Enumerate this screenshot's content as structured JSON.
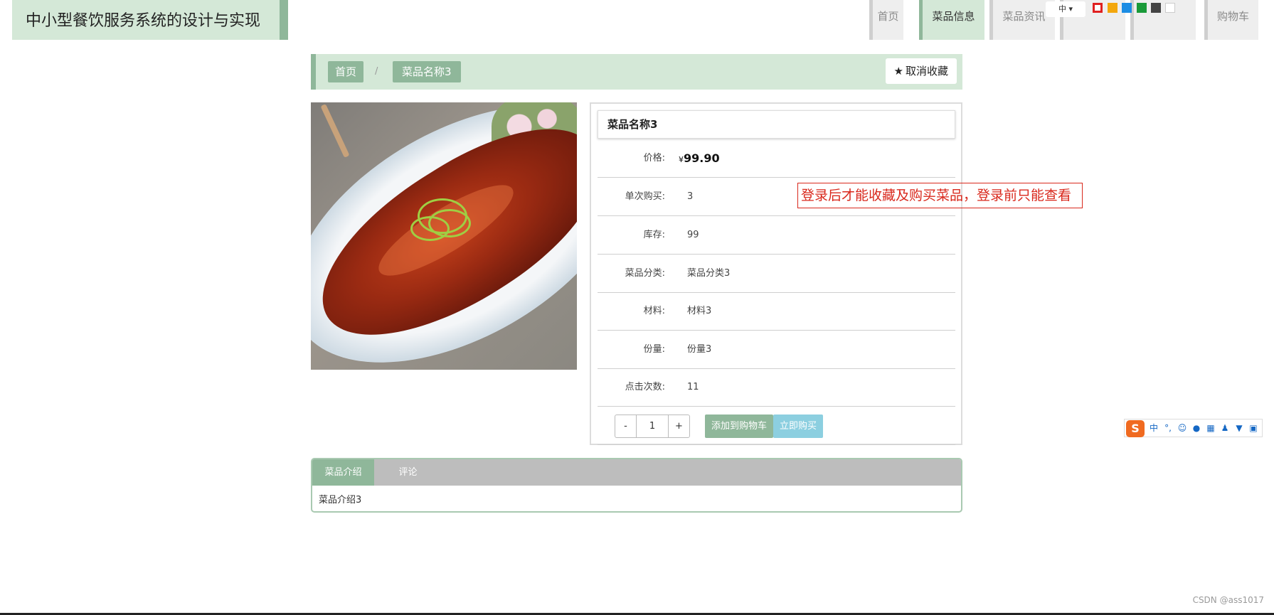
{
  "site": {
    "title": "中小型餐饮服务系统的设计与实现"
  },
  "nav": {
    "items": [
      {
        "label": "首页"
      },
      {
        "label": "菜品信息"
      },
      {
        "label": "菜品资讯"
      },
      {
        "label": ""
      },
      {
        "label": ""
      },
      {
        "label": "购物车"
      }
    ]
  },
  "topbar": {
    "lang_label": "中 ▾",
    "theme_colors": [
      "#e02020",
      "#f3a70d",
      "#1c8de4",
      "#1a9a39",
      "#444444",
      "#ffffff"
    ]
  },
  "breadcrumb": {
    "home": "首页",
    "separator": "/",
    "current": "菜品名称3"
  },
  "favorite": {
    "label": "取消收藏",
    "icon": "star-icon"
  },
  "dish": {
    "name": "菜品名称3",
    "currency": "¥",
    "price": "99.90",
    "price_label": "价格:",
    "fields": [
      {
        "label": "单次购买:",
        "value": "3"
      },
      {
        "label": "库存:",
        "value": "99"
      },
      {
        "label": "菜品分类:",
        "value": "菜品分类3"
      },
      {
        "label": "材料:",
        "value": "材料3"
      },
      {
        "label": "份量:",
        "value": "份量3"
      },
      {
        "label": "点击次数:",
        "value": "11"
      }
    ],
    "quantity": {
      "minus": "-",
      "value": "1",
      "plus": "+"
    },
    "add_to_cart": "添加到购物车",
    "buy_now": "立即购买"
  },
  "annotation": "登录后才能收藏及购买菜品，登录前只能查看",
  "tabs": {
    "items": [
      {
        "label": "菜品介绍"
      },
      {
        "label": "评论"
      }
    ],
    "active_content": "菜品介绍3"
  },
  "ime": {
    "logo": "S",
    "mode": "中",
    "punct": "°,"
  },
  "watermark": "CSDN @ass1017",
  "colors": {
    "accent": "#8fb79a",
    "accent_light": "#d4e8d7",
    "buy": "#8ccfe0",
    "note": "#d9281c"
  }
}
